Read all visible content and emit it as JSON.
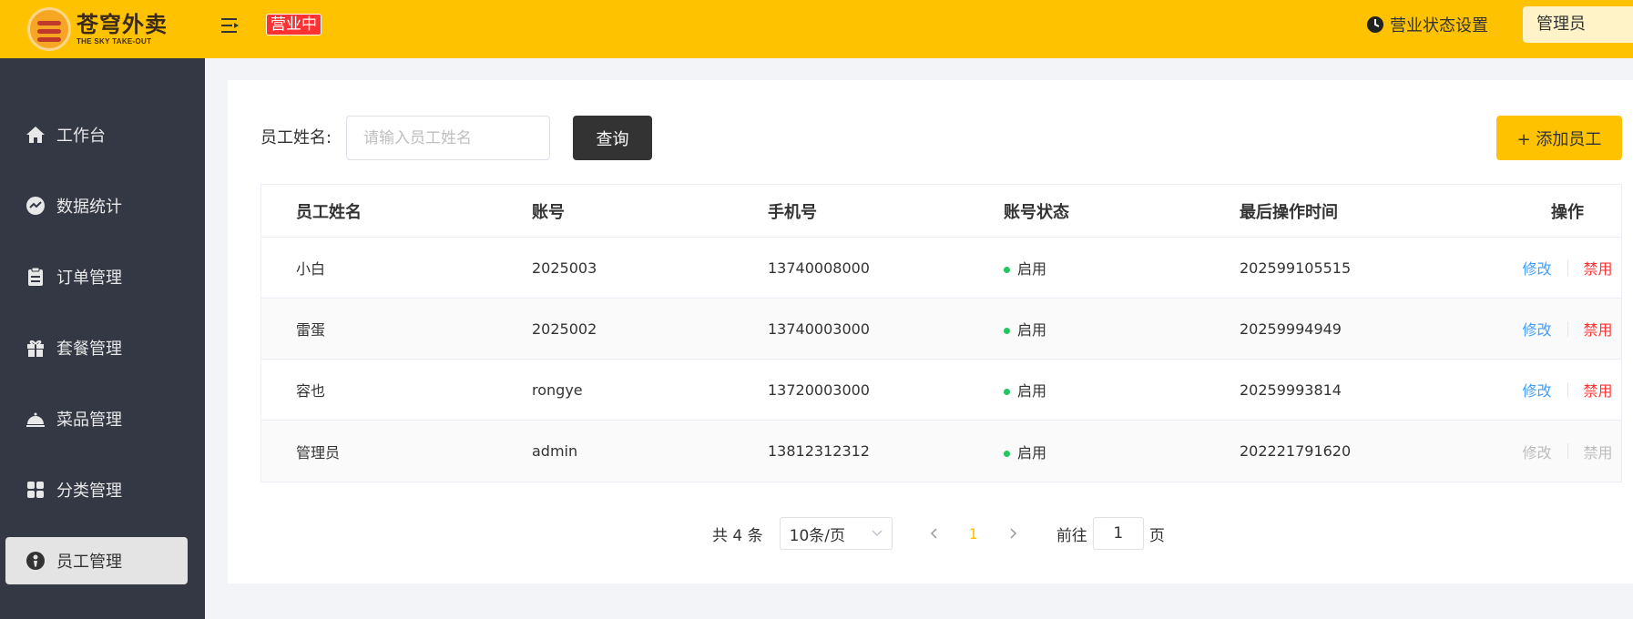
{
  "header": {
    "logo_cn": "苍穹外卖",
    "logo_en": "THE SKY TAKE-OUT",
    "status_badge": "营业中",
    "status_setting_label": "营业状态设置",
    "user_name": "管理员",
    "brand_color": "#ffc200"
  },
  "sidebar": {
    "items": [
      {
        "label": "工作台",
        "icon": "home-icon"
      },
      {
        "label": "数据统计",
        "icon": "chart-icon"
      },
      {
        "label": "订单管理",
        "icon": "clipboard-icon"
      },
      {
        "label": "套餐管理",
        "icon": "gift-icon"
      },
      {
        "label": "菜品管理",
        "icon": "dish-icon"
      },
      {
        "label": "分类管理",
        "icon": "grid-icon"
      },
      {
        "label": "员工管理",
        "icon": "employee-icon",
        "active": true
      }
    ]
  },
  "search": {
    "label": "员工姓名:",
    "placeholder": "请输入员工姓名",
    "value": "",
    "query_button": "查询",
    "add_button": "+ 添加员工"
  },
  "table": {
    "columns": [
      "员工姓名",
      "账号",
      "手机号",
      "账号状态",
      "最后操作时间",
      "操作"
    ],
    "rows": [
      {
        "name": "小白",
        "account": "2025003",
        "phone": "13740008000",
        "status": "启用",
        "last_op": "202599105515",
        "edit": "修改",
        "disable": "禁用",
        "actions_enabled": true
      },
      {
        "name": "雷蛋",
        "account": "2025002",
        "phone": "13740003000",
        "status": "启用",
        "last_op": "20259994949",
        "edit": "修改",
        "disable": "禁用",
        "actions_enabled": true
      },
      {
        "name": "容也",
        "account": "rongye",
        "phone": "13720003000",
        "status": "启用",
        "last_op": "20259993814",
        "edit": "修改",
        "disable": "禁用",
        "actions_enabled": true
      },
      {
        "name": "管理员",
        "account": "admin",
        "phone": "13812312312",
        "status": "启用",
        "last_op": "202221791620",
        "edit": "修改",
        "disable": "禁用",
        "actions_enabled": false
      }
    ]
  },
  "pagination": {
    "total_label": "共 4 条",
    "page_size": "10条/页",
    "current_page": "1",
    "goto_label": "前往",
    "goto_value": "1",
    "page_suffix": "页"
  }
}
